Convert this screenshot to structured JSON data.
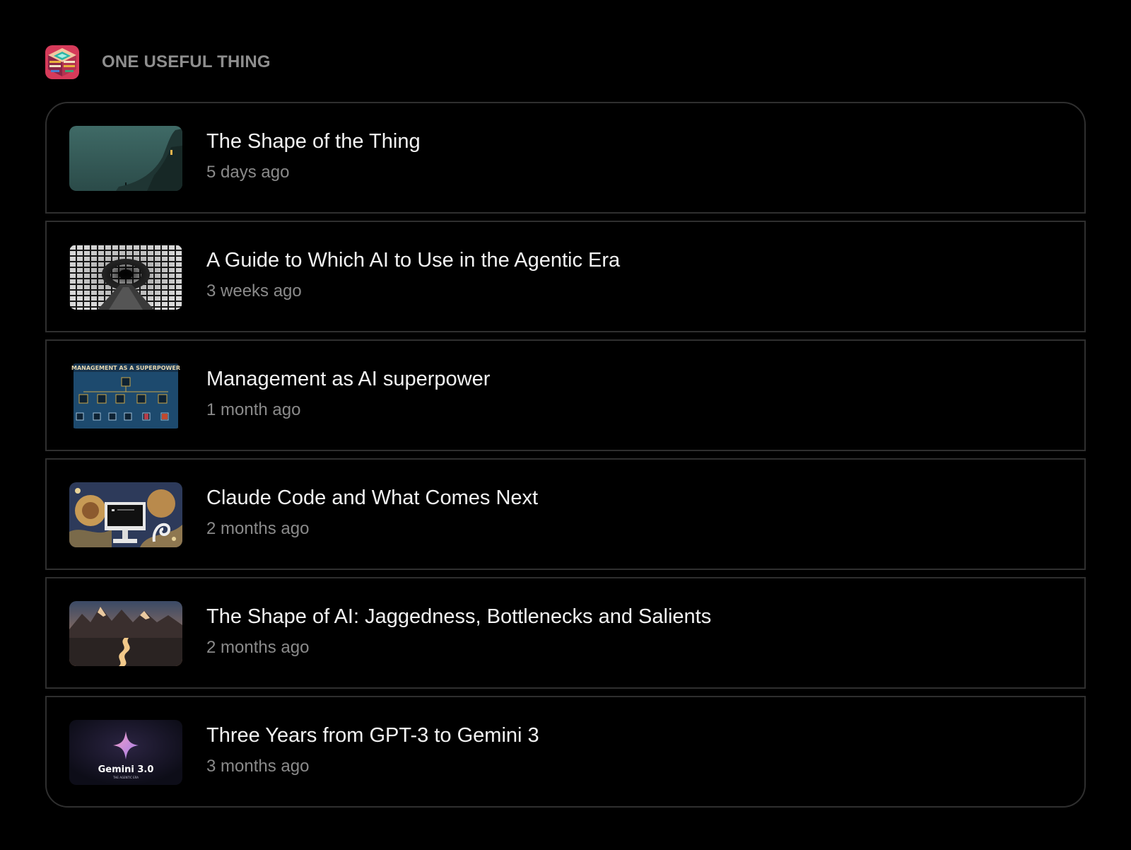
{
  "publication": {
    "name": "ONE USEFUL THING",
    "logo_icon": "isometric-books-logo-icon"
  },
  "posts": [
    {
      "title": "The Shape of the Thing",
      "date": "5 days ago",
      "thumbnail": "foggy-cliff-thumbnail"
    },
    {
      "title": "A Guide to Which AI to Use in the Agentic Era",
      "date": "3 weeks ago",
      "thumbnail": "screens-tunnel-thumbnail"
    },
    {
      "title": "Management as AI superpower",
      "date": "1 month ago",
      "thumbnail": "org-chart-thumbnail",
      "thumbnail_text": "MANAGEMENT AS A SUPERPOWER"
    },
    {
      "title": "Claude Code and What Comes Next",
      "date": "2 months ago",
      "thumbnail": "computer-tapestry-thumbnail"
    },
    {
      "title": "The Shape of AI: Jaggedness, Bottlenecks and Salients",
      "date": "2 months ago",
      "thumbnail": "mountain-river-thumbnail"
    },
    {
      "title": "Three Years from GPT-3 to Gemini 3",
      "date": "3 months ago",
      "thumbnail": "gemini-star-thumbnail",
      "thumbnail_text": "Gemini 3.0",
      "thumbnail_subtext": "THE AGENTIC ERA"
    }
  ],
  "colors": {
    "background": "#000000",
    "border": "#2f2f2f",
    "title": "#f2f2f2",
    "muted": "#8a8a8a"
  }
}
